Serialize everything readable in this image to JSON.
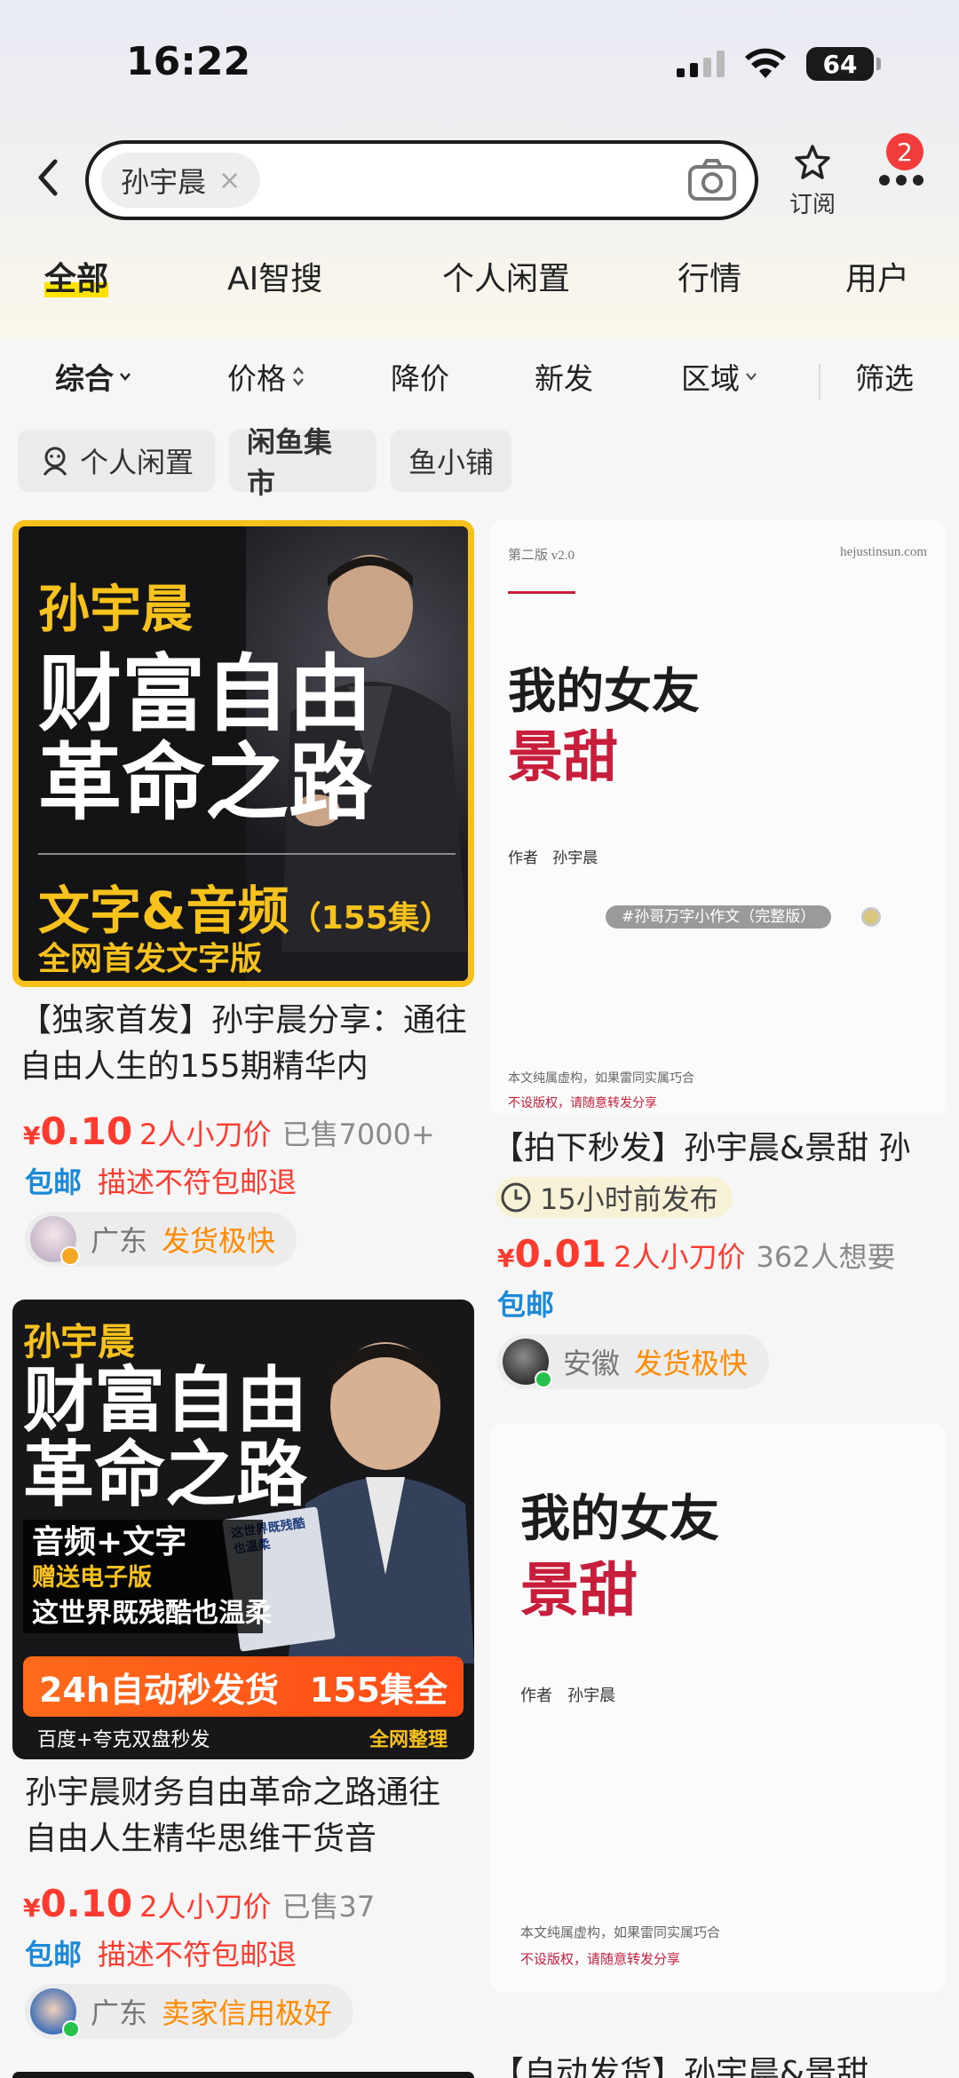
{
  "status_bar": {
    "time": "16:22",
    "battery": "64"
  },
  "search": {
    "query": "孙宇晨",
    "clear_glyph": "×"
  },
  "header": {
    "subscribe_label": "订阅",
    "notification_count": "2"
  },
  "tabs": [
    "全部",
    "AI智搜",
    "个人闲置",
    "行情",
    "用户"
  ],
  "filters": [
    "综合",
    "价格",
    "降价",
    "新发",
    "区域",
    "筛选"
  ],
  "quick_filters": [
    "个人闲置",
    "闲鱼集市",
    "鱼小铺"
  ],
  "products": [
    {
      "thumb": {
        "name": "孙宇晨",
        "line1": "财富自由",
        "line2": "革命之路",
        "sub": "文字&音频",
        "count": "（155集）",
        "foot": "全网首发文字版"
      },
      "title": "【独家首发】孙宇晨分享：通往自由人生的155期精华内",
      "currency": "¥",
      "price": "0.10",
      "promo": "2人小刀价",
      "sold": "已售7000+",
      "tags": [
        "包邮",
        "描述不符包邮退"
      ],
      "location": "广东",
      "seller_tag": "发货极快"
    },
    {
      "thumb": {
        "version": "第二版 v2.0",
        "site": "hejustinsun.com",
        "line1": "我的女友",
        "line2": "景甜",
        "author_label": "作者",
        "author": "孙宇晨",
        "hashtag": "#孙哥万字小作文（完整版）",
        "disclaimer1": "本文纯属虚构，如果雷同实属巧合",
        "disclaimer2": "不设版权，请随意转发分享"
      },
      "title": "【拍下秒发】孙宇晨&景甜 孙",
      "posted": "15小时前发布",
      "currency": "¥",
      "price": "0.01",
      "promo": "2人小刀价",
      "sold": "362人想要",
      "tags": [
        "包邮"
      ],
      "location": "安徽",
      "seller_tag": "发货极快"
    },
    {
      "thumb": {
        "name": "孙宇晨",
        "line1": "财富自由",
        "line2": "革命之路",
        "sub1": "音频+文字",
        "sub2": "赠送电子版",
        "sub3": "这世界既残酷也温柔",
        "book": "这世界既残酷也温柔",
        "band_left": "24h自动秒发货",
        "band_right": "155集全",
        "foot_left": "百度+夸克双盘秒发",
        "foot_right": "全网整理"
      },
      "title": "孙宇晨财务自由革命之路通往自由人生精华思维干货音",
      "currency": "¥",
      "price": "0.10",
      "promo": "2人小刀价",
      "sold": "已售37",
      "tags": [
        "包邮",
        "描述不符包邮退"
      ],
      "location": "广东",
      "seller_tag": "卖家信用极好"
    },
    {
      "thumb": {
        "line1": "我的女友",
        "line2": "景甜",
        "author_label": "作者",
        "author": "孙宇晨",
        "disclaimer1": "本文纯属虚构，如果雷同实属巧合",
        "disclaimer2": "不设版权，请随意转发分享"
      }
    },
    {
      "title": "【自动发货】孙宇晨&景甜"
    }
  ]
}
